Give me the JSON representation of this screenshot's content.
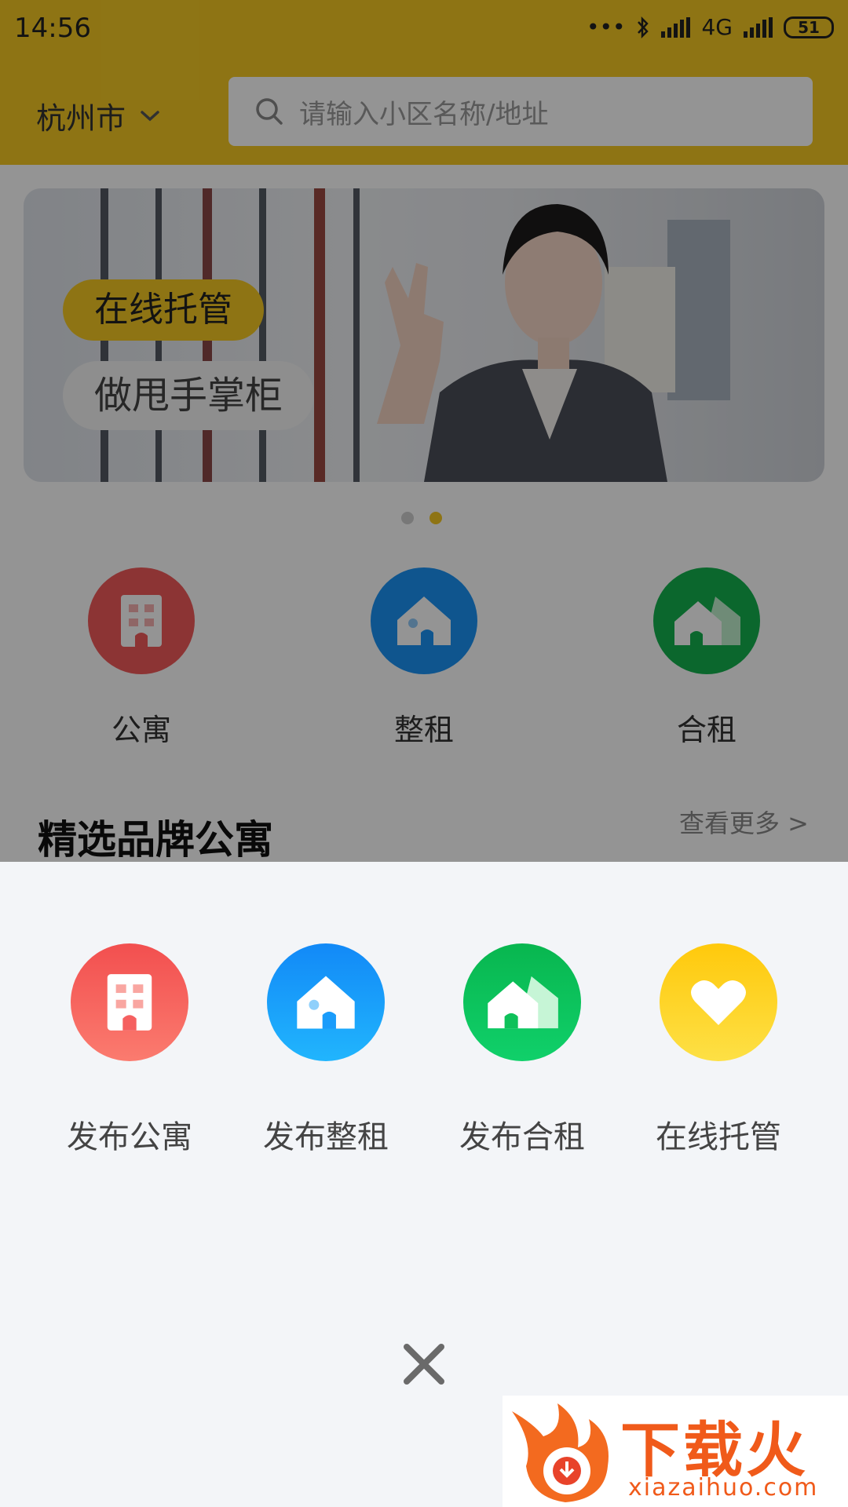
{
  "status_bar": {
    "time": "14:56",
    "network": "4G",
    "battery": "51"
  },
  "header": {
    "city": "杭州市",
    "search_placeholder": "请输入小区名称/地址"
  },
  "banner": {
    "badge_primary": "在线托管",
    "badge_secondary": "做甩手掌柜",
    "total_slides": 2,
    "active_slide": 2
  },
  "categories": [
    {
      "label": "公寓",
      "icon": "apartment-icon",
      "color": "#f25b5b"
    },
    {
      "label": "整租",
      "icon": "house-icon",
      "color": "#1a93f5"
    },
    {
      "label": "合租",
      "icon": "shared-house-icon",
      "color": "#13b24f"
    }
  ],
  "section": {
    "title": "精选品牌公寓",
    "more": "查看更多 >"
  },
  "sheet": {
    "items": [
      {
        "label": "发布公寓",
        "icon": "apartment-icon",
        "color": "#f25b5b"
      },
      {
        "label": "发布整租",
        "icon": "house-icon",
        "color": "#1a9cfb"
      },
      {
        "label": "发布合租",
        "icon": "shared-house-icon",
        "color": "#0fc15a"
      },
      {
        "label": "在线托管",
        "icon": "heart-icon",
        "color": "#fbcc18"
      }
    ]
  },
  "watermark": {
    "text": "下载火",
    "url": "xiazaihuo.com"
  }
}
